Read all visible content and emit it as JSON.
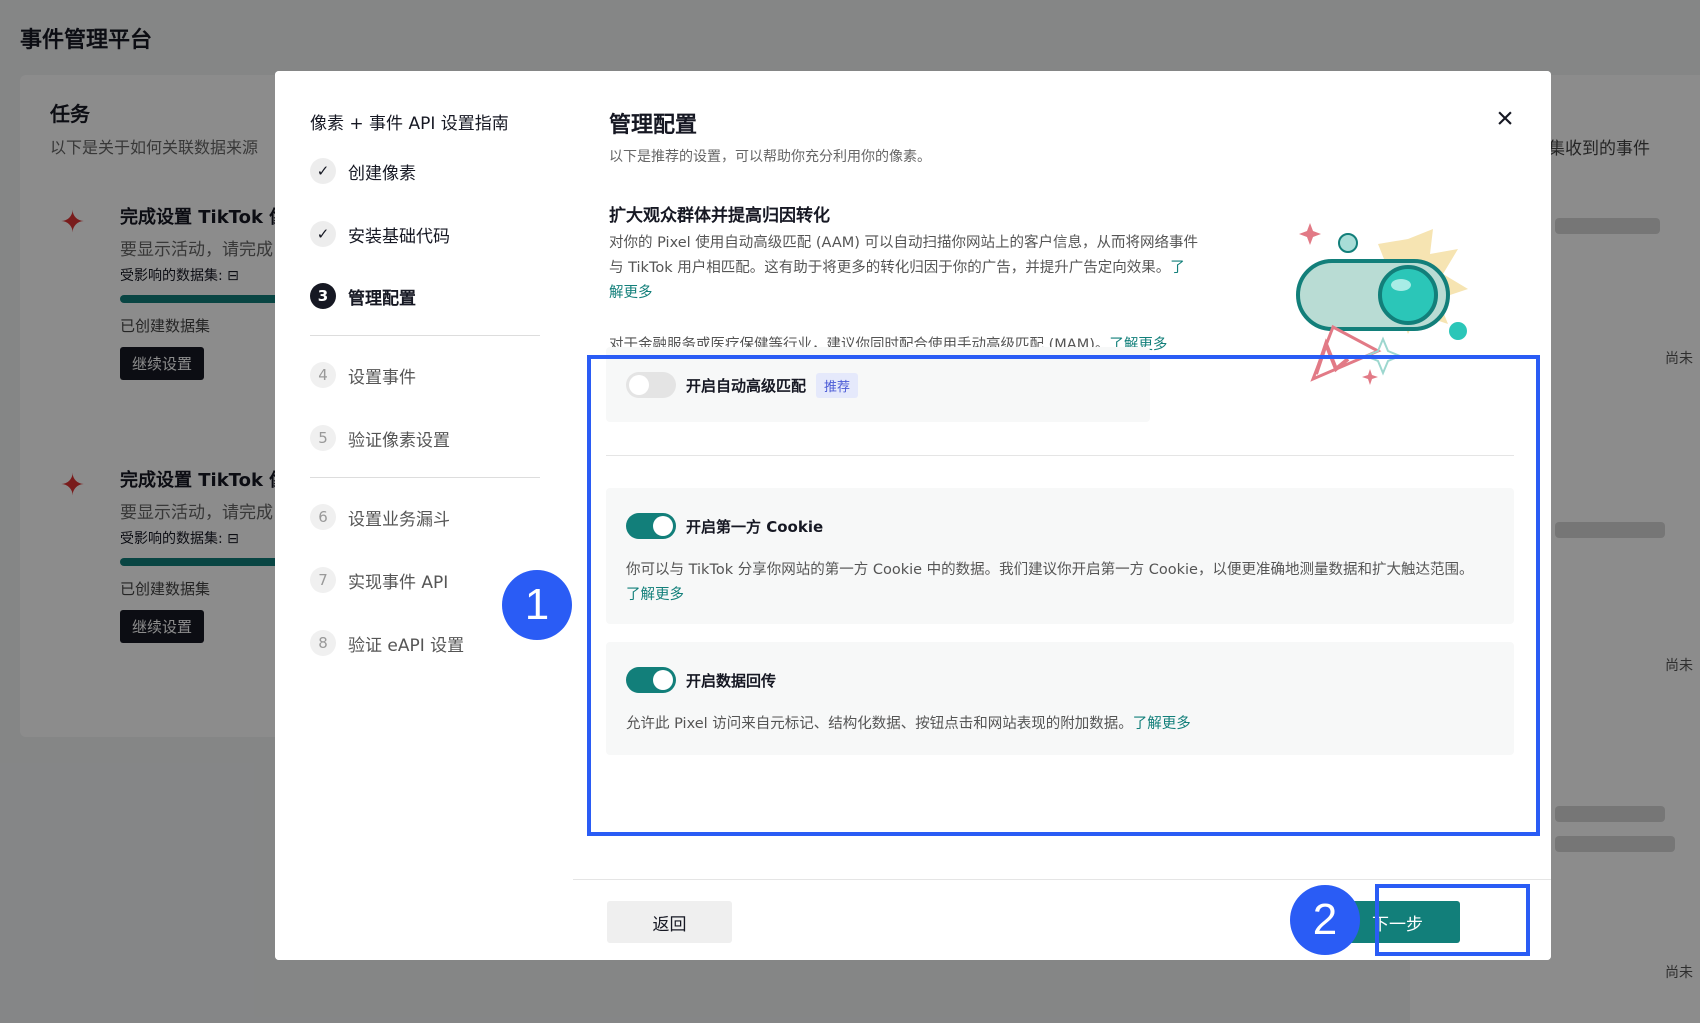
{
  "background": {
    "page_title": "事件管理平台",
    "task_title": "任务",
    "task_subtitle": "以下是关于如何关联数据来源",
    "right_text": "集收到的事件",
    "items": [
      {
        "title": "完成设置 TikTok 像素",
        "subtitle": "要显示活动，请完成",
        "affected": "受影响的数据集: ⊟",
        "status": "已创建数据集",
        "button": "继续设置"
      },
      {
        "title": "完成设置 TikTok 像素",
        "subtitle": "要显示活动，请完成",
        "affected": "受影响的数据集: ⊟",
        "status": "已创建数据集",
        "button": "继续设置"
      }
    ],
    "not_yet": "尚未"
  },
  "steps": {
    "title": "像素 + 事件 API 设置指南",
    "items": [
      {
        "marker": "✓",
        "label": "创建像素",
        "state": "done"
      },
      {
        "marker": "✓",
        "label": "安装基础代码",
        "state": "done"
      },
      {
        "marker": "3",
        "label": "管理配置",
        "state": "active"
      },
      {
        "marker": "4",
        "label": "设置事件",
        "state": "todo"
      },
      {
        "marker": "5",
        "label": "验证像素设置",
        "state": "todo"
      },
      {
        "marker": "6",
        "label": "设置业务漏斗",
        "state": "todo"
      },
      {
        "marker": "7",
        "label": "实现事件 API",
        "state": "todo"
      },
      {
        "marker": "8",
        "label": "验证 eAPI 设置",
        "state": "todo"
      }
    ]
  },
  "content": {
    "title": "管理配置",
    "subtitle": "以下是推荐的设置，可以帮助你充分利用你的像素。",
    "close": "×",
    "section_heading": "扩大观众群体并提高归因转化",
    "section_desc": "对你的 Pixel 使用自动高级匹配 (AAM) 可以自动扫描你网站上的客户信息，从而将网络事件与 TikTok 用户相匹配。这有助于将更多的转化归因于你的广告，并提升广告定向效果。",
    "learn_more": "了解更多",
    "section_note": "对于金融服务或医疗保健等行业，建议你同时配合使用手动高级匹配 (MAM)。",
    "options": {
      "aam": {
        "label": "开启自动高级匹配",
        "badge": "推荐",
        "enabled": false
      },
      "cookie": {
        "label": "开启第一方 Cookie",
        "desc": "你可以与 TikTok 分享你网站的第一方 Cookie 中的数据。我们建议你开启第一方 Cookie，以便更准确地测量数据和扩大触达范围。",
        "enabled": true
      },
      "postback": {
        "label": "开启数据回传",
        "desc": "允许此 Pixel 访问来自元标记、结构化数据、按钮点击和网站表现的附加数据。",
        "enabled": true
      }
    },
    "back_button": "返回",
    "next_button": "下一步"
  },
  "annotations": {
    "one": "1",
    "two": "2",
    "color": "#2a5cf5"
  },
  "colors": {
    "accent": "#127f7a",
    "dark": "#161823"
  }
}
